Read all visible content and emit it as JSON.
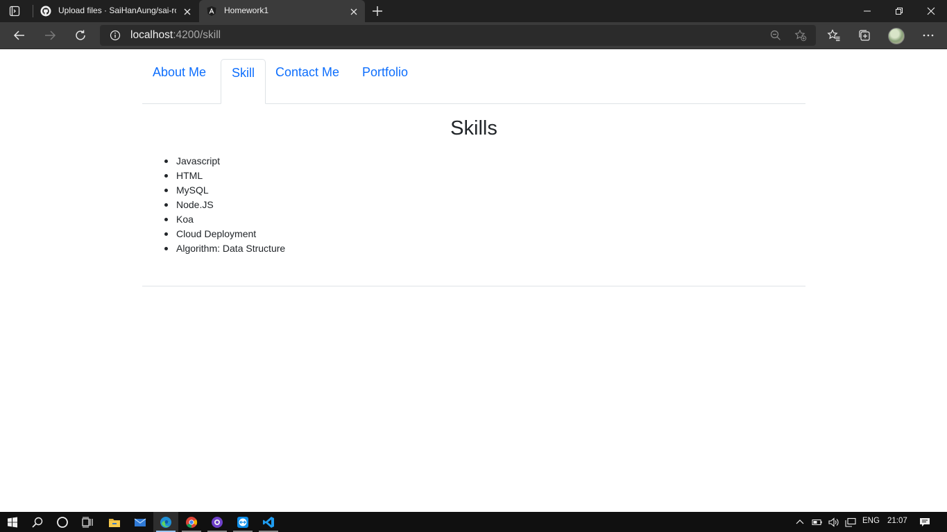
{
  "browser": {
    "tabs": [
      {
        "title": "Upload files · SaiHanAung/sai-ro",
        "favicon": "github-icon",
        "active": false
      },
      {
        "title": "Homework1",
        "favicon": "angular-icon",
        "active": true
      }
    ],
    "address": {
      "host": "localhost",
      "path": ":4200/skill"
    }
  },
  "site": {
    "nav": [
      {
        "label": "About Me",
        "active": false
      },
      {
        "label": "Skill",
        "active": true
      },
      {
        "label": "Contact Me",
        "active": false
      },
      {
        "label": "Portfolio",
        "active": false
      }
    ],
    "heading": "Skills",
    "skills": [
      "Javascript",
      "HTML",
      "MySQL",
      "Node.JS",
      "Koa",
      "Cloud Deployment",
      "Algorithm: Data Structure"
    ]
  },
  "taskbar": {
    "apps": [
      "windows-start-icon",
      "search-icon",
      "cortana-icon",
      "task-view-icon",
      "file-explorer-icon",
      "mail-icon",
      "edge-icon",
      "chrome-icon",
      "github-desktop-icon",
      "teamviewer-icon",
      "vscode-icon"
    ],
    "language": "ENG",
    "clock": "21:07"
  },
  "colors": {
    "link": "#0d6efd",
    "text": "#212529",
    "border": "#dee2e6",
    "chrome_dark": "#202020",
    "chrome_toolbar": "#3b3b3b"
  }
}
